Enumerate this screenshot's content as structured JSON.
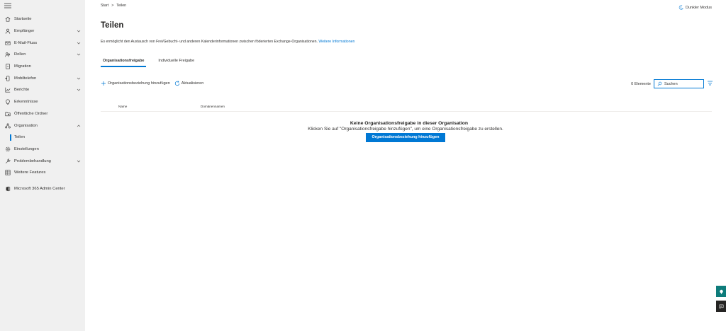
{
  "sidebar": {
    "items": [
      {
        "label": "Startseite",
        "icon": "home-icon",
        "chevron": false
      },
      {
        "label": "Empfänger",
        "icon": "person-icon",
        "chevron": true
      },
      {
        "label": "E-Mail-Fluss",
        "icon": "mail-icon",
        "chevron": true
      },
      {
        "label": "Rollen",
        "icon": "people-icon",
        "chevron": true
      },
      {
        "label": "Migration",
        "icon": "document-icon",
        "chevron": false
      },
      {
        "label": "Mobiltelefon",
        "icon": "mobile-icon",
        "chevron": true
      },
      {
        "label": "Berichte",
        "icon": "chart-icon",
        "chevron": true
      },
      {
        "label": "Erkenntnisse",
        "icon": "lightbulb-icon",
        "chevron": false
      },
      {
        "label": "Öffentliche Ordner",
        "icon": "folder-icon",
        "chevron": false
      },
      {
        "label": "Organisation",
        "icon": "org-icon",
        "chevron": true
      },
      {
        "label": "Teilen",
        "icon": "",
        "chevron": false
      },
      {
        "label": "Einstellungen",
        "icon": "gear-icon",
        "chevron": false
      },
      {
        "label": "Problembehandlung",
        "icon": "wrench-icon",
        "chevron": true
      },
      {
        "label": "Weitere Features",
        "icon": "grid-icon",
        "chevron": false
      }
    ],
    "admin_center": "Microsoft 365 Admin Center"
  },
  "header": {
    "breadcrumb": [
      "Start",
      "Teilen"
    ],
    "dark_mode": "Dunkler Modus"
  },
  "page": {
    "title": "Teilen",
    "description": "Es ermöglicht den Austausch von Frei/Gebucht- und anderen Kalenderinformationen zwischen föderierten Exchange-Organisationen.",
    "more_info": "Weitere Informationen",
    "tabs": [
      "Organisationsfreigabe",
      "Individuelle Freigabe"
    ]
  },
  "toolbar": {
    "add_label": "Organisationsbeziehung hinzufügen",
    "refresh_label": "Aktualisieren",
    "count": "0 Elemente",
    "search_placeholder": "Suchen"
  },
  "table": {
    "columns": [
      "Name",
      "Domänennamen"
    ]
  },
  "empty_state": {
    "title": "Keine Organisationsfreigabe in dieser Organisation",
    "subtitle": "Klicken Sie auf \"Organisationsfreigabe hinzufügen\", um eine Organisationsfreigabe zu erstellen.",
    "button": "Organisationsbeziehung hinzufügen"
  },
  "colors": {
    "accent": "#0078d4",
    "sidebar_bg": "#f0f0f0",
    "float_teal": "#0e7c7b"
  }
}
